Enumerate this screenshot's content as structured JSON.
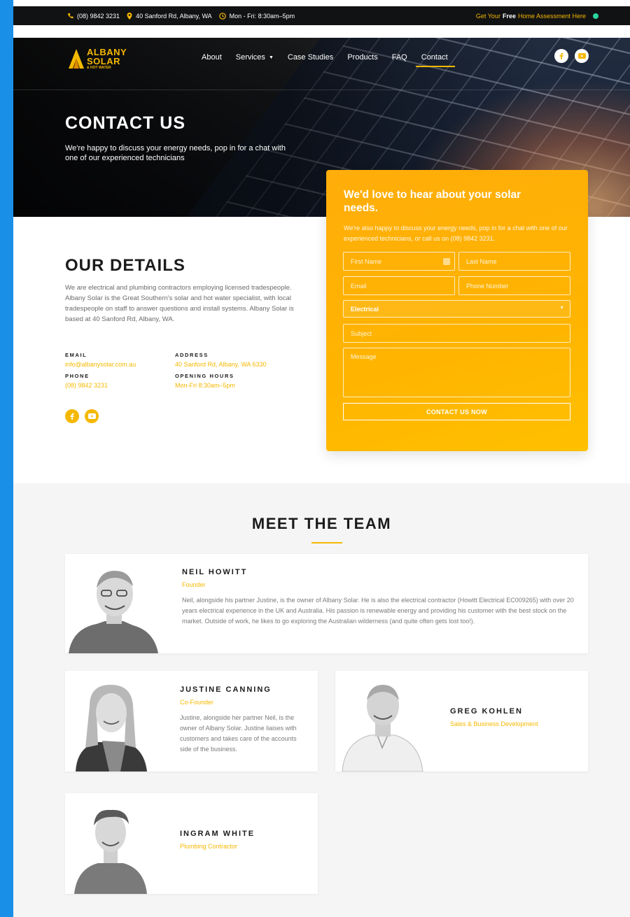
{
  "topbar": {
    "phone": "(08) 9842 3231",
    "address": "40 Sanford Rd, Albany, WA",
    "hours": "Mon - Fri: 8:30am–5pm",
    "assessment_pre": "Get Your",
    "assessment_bold": "Free",
    "assessment_post": "Home Assessment Here"
  },
  "logo": {
    "line1": "ALBANY",
    "line2": "SOLAR",
    "line3": "& HOT WATER"
  },
  "nav": {
    "items": [
      "About",
      "Services",
      "Case Studies",
      "Products",
      "FAQ",
      "Contact"
    ],
    "active": "Contact"
  },
  "hero": {
    "title": "CONTACT US",
    "subtitle": "We're happy to discuss your energy needs, pop in for a chat with one of our experienced technicians"
  },
  "details": {
    "title": "OUR DETAILS",
    "text": "We are electrical and plumbing contractors employing licensed tradespeople. Albany Solar is the Great Southern's solar and hot water specialist, with local tradespeople on staff to answer questions and install systems. Albany Solar is based at 40 Sanford Rd, Albany, WA.",
    "email_label": "EMAIL",
    "email": "info@albanysolar.com.au",
    "phone_label": "PHONE",
    "phone": "(08) 9842 3231",
    "address_label": "ADDRESS",
    "address": "40 Sanford Rd, Albany, WA 6330",
    "hours_label": "OPENING HOURS",
    "hours": "Mon-Fri 8:30am–5pm"
  },
  "form": {
    "title": "We'd love to hear about your solar needs.",
    "subtitle": "We're also happy to discuss your energy needs, pop in for a chat with one of our experienced technicians, or call us on (08) 9842 3231.",
    "first_name": "First Name",
    "last_name": "Last Name",
    "email": "Email",
    "phone": "Phone Number",
    "service_selected": "Electrical",
    "subject": "Subject",
    "message": "Message",
    "submit": "CONTACT US NOW"
  },
  "team": {
    "title": "MEET THE TEAM",
    "members": [
      {
        "name": "NEIL HOWITT",
        "role": "Founder",
        "bio": "Neil, alongside his partner Justine, is the owner of Albany Solar. He is also the electrical contractor (Howitt Electrical EC009265) with over 20 years electrical experience in the UK and Australia. His passion is renewable energy and providing his customer with the best stock on the market. Outside of work, he likes to go exploring the Australian wilderness (and quite often gets lost too!)."
      },
      {
        "name": "JUSTINE CANNING",
        "role": "Co-Founder",
        "bio": "Justine, alongside her partner Neil, is the owner of Albany Solar. Justine liaises with customers and takes care of the accounts side of the business."
      },
      {
        "name": "GREG KOHLEN",
        "role": "Sales & Business Development",
        "bio": ""
      },
      {
        "name": "INGRAM WHITE",
        "role": "Plumbing Contractor",
        "bio": ""
      }
    ]
  },
  "colors": {
    "accent": "#f5b800",
    "dark": "#111214",
    "frame": "#1a8fe8",
    "status": "#2bd69c"
  }
}
